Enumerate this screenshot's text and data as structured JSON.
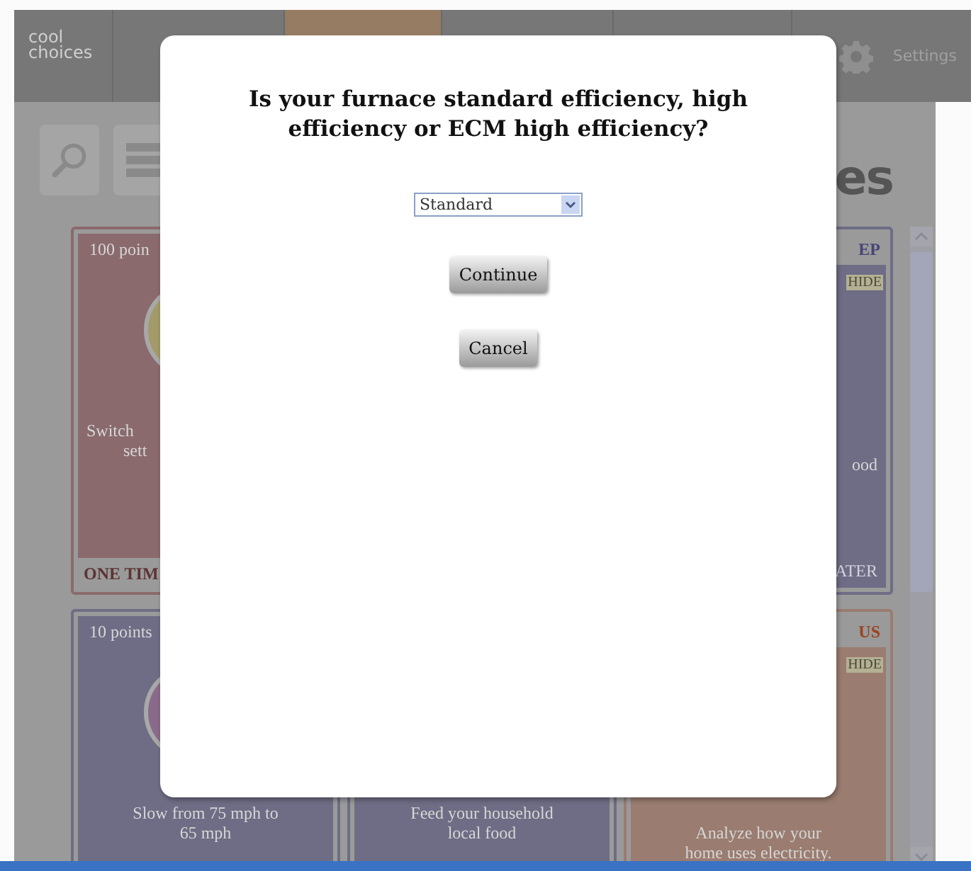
{
  "header": {
    "logo": [
      "cool",
      "choices"
    ],
    "nav_tabs": [
      {
        "selected": false
      },
      {
        "selected": true
      },
      {
        "selected": false
      },
      {
        "selected": false
      }
    ],
    "settings": "Settings"
  },
  "page_title_fragment": "es",
  "cards": [
    {
      "kind": "left-cut",
      "color": "#8a6a6d",
      "points": "100 poin",
      "circle": {
        "color": "#a39a6a"
      },
      "text": [
        "Switch",
        "sett"
      ],
      "footer": "ONE TIM"
    },
    {
      "kind": "hidden"
    },
    {
      "kind": "right-cut",
      "color": "#6e6d85",
      "header": "EP",
      "hide": "HIDE",
      "text": [
        "ood"
      ],
      "footer": "ATER"
    },
    {
      "kind": "full",
      "color": "#6e6d85",
      "points": "10 points",
      "circle": {
        "color": "#8a6a8a"
      },
      "text": [
        "Slow from 75 mph to",
        "65 mph"
      ]
    },
    {
      "kind": "full",
      "color": "#6e6d85",
      "text": [
        "Feed your household",
        "local food"
      ]
    },
    {
      "kind": "right-cut",
      "color": "#9a7c70",
      "header": "US",
      "hide": "HIDE",
      "text": [
        "Analyze how your",
        "home uses electricity."
      ]
    }
  ],
  "dialog": {
    "question": "Is your furnace standard efficiency, high efficiency or ECM high efficiency?",
    "select_value": "Standard",
    "buttons": [
      "Continue",
      "Cancel"
    ]
  }
}
